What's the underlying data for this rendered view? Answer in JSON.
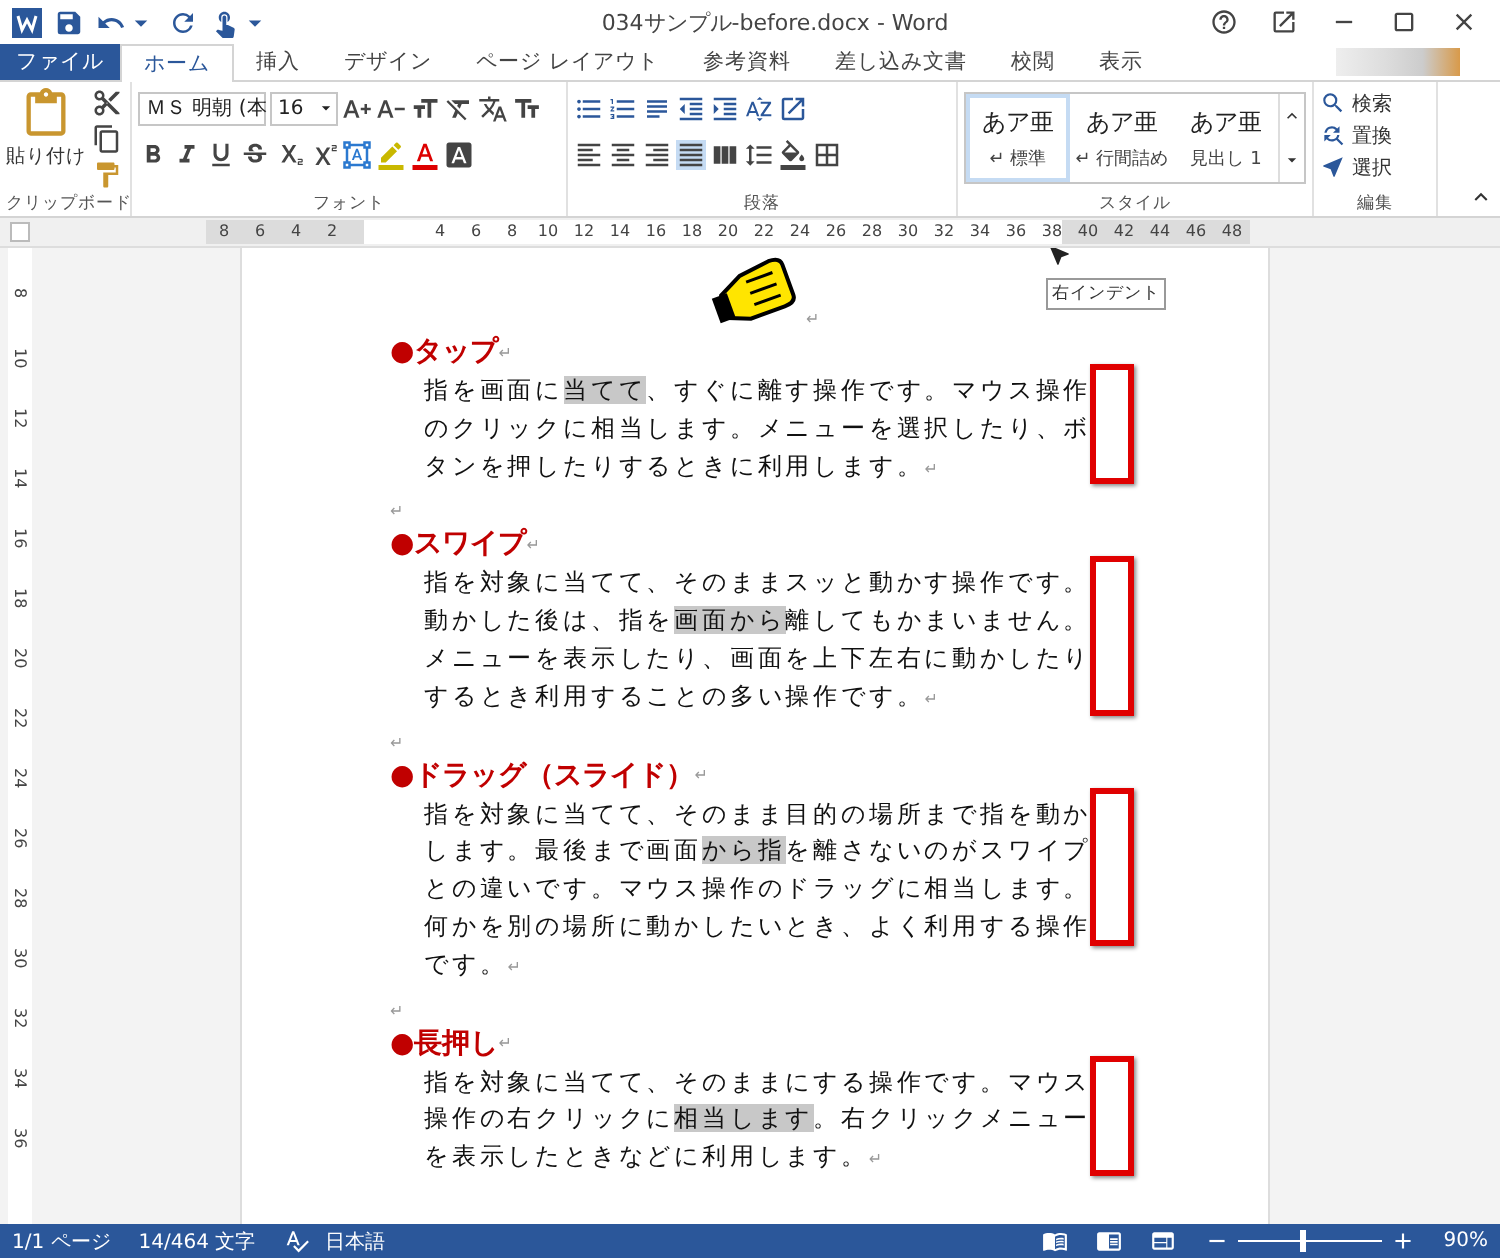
{
  "window": {
    "title": "034サンプル-before.docx - Word"
  },
  "tabs": [
    {
      "label": "ファイル",
      "kind": "file",
      "selected": false
    },
    {
      "label": "ホーム",
      "kind": "tab",
      "selected": true
    },
    {
      "label": "挿入",
      "kind": "tab",
      "selected": false
    },
    {
      "label": "デザイン",
      "kind": "tab",
      "selected": false
    },
    {
      "label": "ページ レイアウト",
      "kind": "tab",
      "selected": false
    },
    {
      "label": "参考資料",
      "kind": "tab",
      "selected": false
    },
    {
      "label": "差し込み文書",
      "kind": "tab",
      "selected": false
    },
    {
      "label": "校閲",
      "kind": "tab",
      "selected": false
    },
    {
      "label": "表示",
      "kind": "tab",
      "selected": false
    }
  ],
  "ribbon": {
    "clipboard": {
      "label": "クリップボード",
      "paste": "貼り付け"
    },
    "font": {
      "label": "フォント",
      "name": "ＭＳ 明朝 (本",
      "size": "16"
    },
    "paragraph": {
      "label": "段落"
    },
    "styles": {
      "label": "スタイル",
      "items": [
        {
          "preview": "あア亜",
          "name": "↵ 標準",
          "selected": true
        },
        {
          "preview": "あア亜",
          "name": "↵ 行間詰め",
          "selected": false
        },
        {
          "preview": "あア亜",
          "name": "見出し 1",
          "selected": false
        }
      ]
    },
    "editing": {
      "label": "編集",
      "items": [
        "検索",
        "置換",
        "選択"
      ]
    }
  },
  "ruler": {
    "left_labels": [
      "8",
      "6",
      "4",
      "2"
    ],
    "right_labels": [
      "4",
      "6",
      "8",
      "10",
      "12",
      "14",
      "16",
      "18",
      "20",
      "22",
      "24",
      "26",
      "28",
      "30",
      "32",
      "34",
      "36",
      "38",
      "40",
      "42",
      "44",
      "46",
      "48"
    ],
    "tooltip": "右インデント"
  },
  "vertical_ruler": {
    "labels": [
      "8",
      "10",
      "12",
      "14",
      "16",
      "18",
      "20",
      "22",
      "24",
      "26",
      "28",
      "30",
      "32",
      "34",
      "36"
    ]
  },
  "document": {
    "blocks": [
      {
        "kind": "picture",
        "mark": "↵"
      },
      {
        "kind": "heading",
        "text": "●タップ",
        "mark": "↵"
      },
      {
        "kind": "body",
        "outlined": true,
        "mark": "↵",
        "lines": [
          {
            "segments": [
              {
                "text": "指を画面に",
                "highlighted": false
              },
              {
                "text": "当てて",
                "highlighted": true
              },
              {
                "text": "、すぐに離す操作です。マウス操作",
                "highlighted": false
              }
            ]
          },
          {
            "segments": [
              {
                "text": "のクリックに相当します。メニューを選択したり、ボ",
                "highlighted": false
              }
            ]
          },
          {
            "segments": [
              {
                "text": "タンを押したりするときに利用します。",
                "highlighted": false
              }
            ]
          }
        ]
      },
      {
        "kind": "blank",
        "mark": "↵"
      },
      {
        "kind": "heading",
        "text": "●スワイプ",
        "mark": "↵"
      },
      {
        "kind": "body",
        "outlined": true,
        "mark": "↵",
        "lines": [
          {
            "segments": [
              {
                "text": "指を対象に当てて、そのままスッと動かす操作です。",
                "highlighted": false
              }
            ]
          },
          {
            "segments": [
              {
                "text": "動かした後は、指を",
                "highlighted": false
              },
              {
                "text": "画面から",
                "highlighted": true
              },
              {
                "text": "離してもかまいません。",
                "highlighted": false
              }
            ]
          },
          {
            "segments": [
              {
                "text": "メニューを表示したり、画面を上下左右に動かしたり",
                "highlighted": false
              }
            ]
          },
          {
            "segments": [
              {
                "text": "するとき利用することの多い操作です。",
                "highlighted": false
              }
            ]
          }
        ]
      },
      {
        "kind": "blank",
        "mark": "↵"
      },
      {
        "kind": "heading",
        "text": "●ドラッグ（スライド）",
        "mark": "↵"
      },
      {
        "kind": "body",
        "outlined": true,
        "mark": "↵",
        "lines": [
          {
            "segments": [
              {
                "text": "指を対象に当てて、そのまま目的の場所まで指を動か",
                "highlighted": false
              }
            ]
          },
          {
            "segments": [
              {
                "text": "します。最後まで画面",
                "highlighted": false
              },
              {
                "text": "から指",
                "highlighted": true
              },
              {
                "text": "を離さないのがスワイプ",
                "highlighted": false
              }
            ]
          },
          {
            "segments": [
              {
                "text": "との違いです。マウス操作のドラッグに相当します。",
                "highlighted": false
              }
            ]
          },
          {
            "segments": [
              {
                "text": "何かを別の場所に動かしたいとき、よく利用する操作",
                "highlighted": false
              }
            ]
          },
          {
            "segments": [
              {
                "text": "です。",
                "highlighted": false
              }
            ]
          }
        ]
      },
      {
        "kind": "blank",
        "mark": "↵"
      },
      {
        "kind": "heading",
        "text": "●長押し",
        "mark": "↵"
      },
      {
        "kind": "body",
        "outlined": true,
        "mark": "↵",
        "lines": [
          {
            "segments": [
              {
                "text": "指を対象に当てて、そのままにする操作です。マウス",
                "highlighted": false
              }
            ]
          },
          {
            "segments": [
              {
                "text": "操作の右クリックに",
                "highlighted": false
              },
              {
                "text": "相当します",
                "highlighted": true
              },
              {
                "text": "。右クリックメニュー",
                "highlighted": false
              }
            ]
          },
          {
            "segments": [
              {
                "text": "を表示したときなどに利用します。",
                "highlighted": false
              }
            ]
          }
        ]
      }
    ]
  },
  "status_bar": {
    "page": "1/1 ページ",
    "words": "14/464 文字",
    "language": "日本語",
    "zoom": {
      "level": 0.45,
      "reading": "90%"
    }
  }
}
